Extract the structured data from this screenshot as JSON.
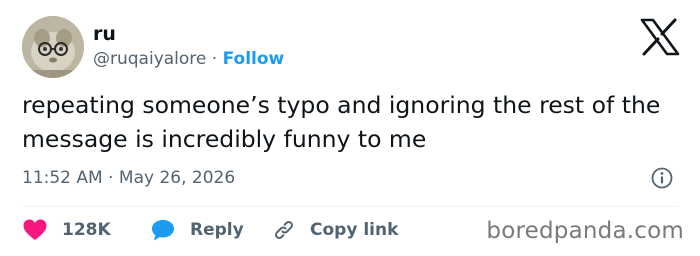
{
  "author": {
    "display_name": "ru",
    "handle": "@ruqaiyalore",
    "separator": "·",
    "follow_label": "Follow"
  },
  "tweet": {
    "text": "repeating someone’s typo and ignoring the rest of the message is incredibly funny to me",
    "timestamp": "11:52 AM · May 26, 2026"
  },
  "actions": {
    "like_count": "128K",
    "reply_label": "Reply",
    "copy_link_label": "Copy link"
  },
  "watermark": "boredpanda.com",
  "icons": {
    "logo": "x-logo-icon",
    "info": "info-icon",
    "like": "heart-icon",
    "reply": "speech-bubble-icon",
    "copy": "link-icon"
  },
  "colors": {
    "follow": "#1d9bf0",
    "heart": "#f91880",
    "reply": "#1d9bf0",
    "muted": "#536471"
  }
}
